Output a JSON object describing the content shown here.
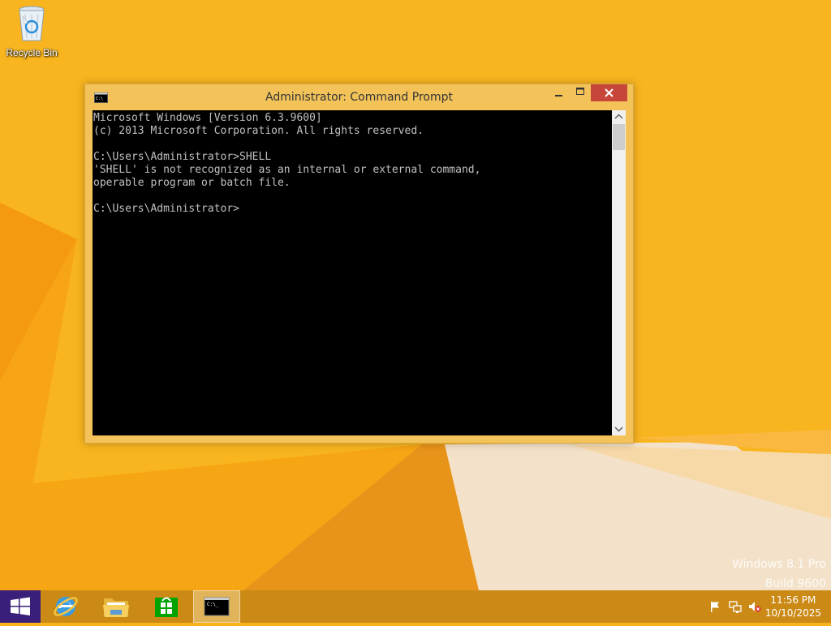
{
  "desktop": {
    "icons": [
      {
        "label": "Recycle Bin",
        "icon": "recycle-bin-icon"
      }
    ],
    "watermark": {
      "line1": "Windows 8.1 Pro",
      "line2": "Build 9600"
    }
  },
  "window": {
    "title": "Administrator: Command Prompt",
    "icon": "console-icon",
    "console_text": "Microsoft Windows [Version 6.3.9600]\n(c) 2013 Microsoft Corporation. All rights reserved.\n\nC:\\Users\\Administrator>SHELL\n'SHELL' is not recognized as an internal or external command,\noperable program or batch file.\n\nC:\\Users\\Administrator>",
    "colors": {
      "frame": "#f3c35a",
      "close": "#c7463a",
      "console_bg": "#000000",
      "console_fg": "#c0c0c0"
    }
  },
  "taskbar": {
    "start_icon": "windows-logo-icon",
    "items": [
      {
        "name": "Internet Explorer",
        "icon": "internet-explorer-icon"
      },
      {
        "name": "File Explorer",
        "icon": "file-explorer-icon"
      },
      {
        "name": "Store",
        "icon": "store-icon"
      },
      {
        "name": "Command Prompt",
        "icon": "command-prompt-icon",
        "active": true
      }
    ],
    "tray": [
      "flag-icon",
      "network-icon",
      "volume-muted-icon"
    ],
    "clock": {
      "time": "11:56 PM",
      "date": "10/10/2025"
    }
  }
}
